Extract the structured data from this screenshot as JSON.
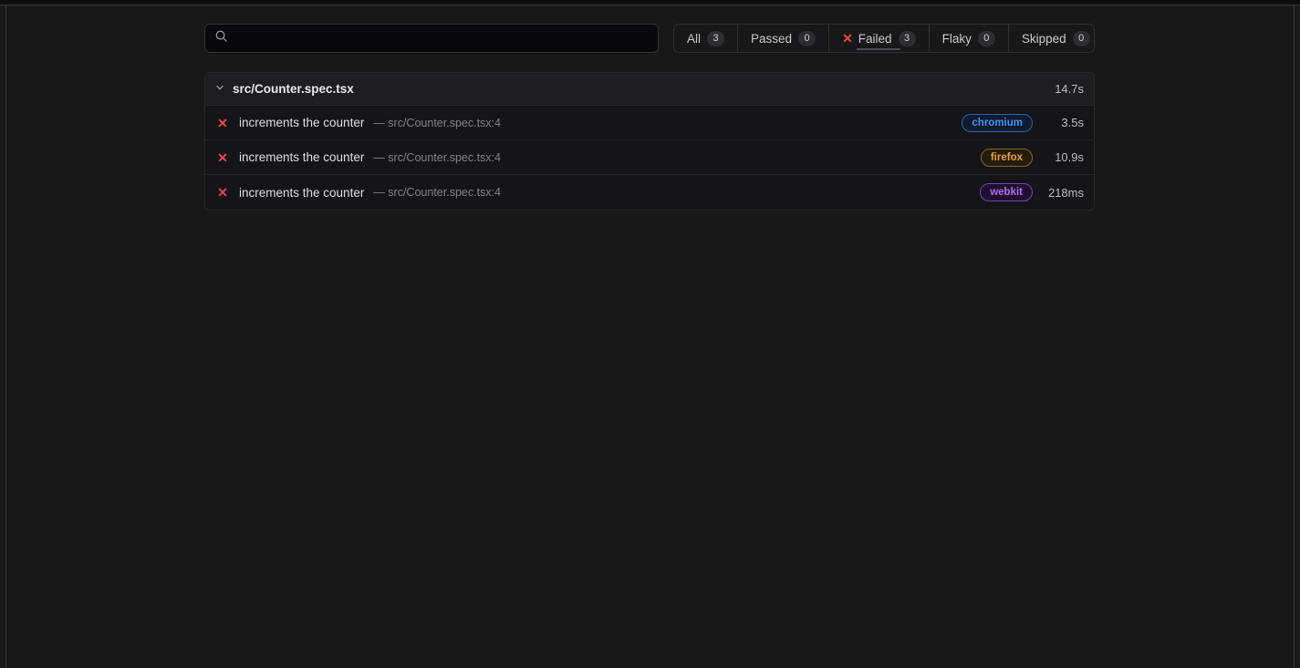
{
  "theme": {
    "page_background": "#17181a",
    "card_background": "#141518",
    "border": "#26282c",
    "fail_color": "#ef4444",
    "chromium_color": "#4a90f0",
    "firefox_color": "#e6a23c",
    "webkit_color": "#b06ef0"
  },
  "toolbar": {
    "search": {
      "icon": "search-icon",
      "value": "",
      "placeholder": ""
    },
    "filters": [
      {
        "id": "all",
        "label": "All",
        "count": "3",
        "active": false,
        "icon": null
      },
      {
        "id": "passed",
        "label": "Passed",
        "count": "0",
        "active": false,
        "icon": null
      },
      {
        "id": "failed",
        "label": "Failed",
        "count": "3",
        "active": true,
        "icon": "x-icon"
      },
      {
        "id": "flaky",
        "label": "Flaky",
        "count": "0",
        "active": false,
        "icon": null
      },
      {
        "id": "skipped",
        "label": "Skipped",
        "count": "0",
        "active": false,
        "icon": null
      }
    ]
  },
  "results": {
    "file": {
      "chevron": "chevron-down-icon",
      "name": "src/Counter.spec.tsx",
      "duration": "14.7s",
      "expanded": true
    },
    "tests": [
      {
        "status_icon": "x-icon",
        "title": "increments the counter",
        "separator": "—",
        "location": "src/Counter.spec.tsx:4",
        "browser": "chromium",
        "duration": "3.5s"
      },
      {
        "status_icon": "x-icon",
        "title": "increments the counter",
        "separator": "—",
        "location": "src/Counter.spec.tsx:4",
        "browser": "firefox",
        "duration": "10.9s"
      },
      {
        "status_icon": "x-icon",
        "title": "increments the counter",
        "separator": "—",
        "location": "src/Counter.spec.tsx:4",
        "browser": "webkit",
        "duration": "218ms"
      }
    ]
  }
}
